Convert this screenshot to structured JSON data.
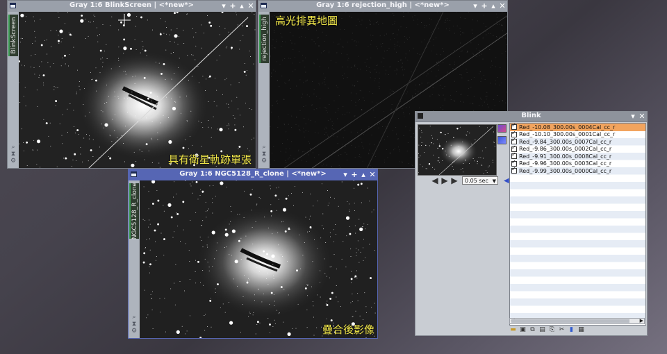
{
  "windows": {
    "blinkscreen": {
      "title": "Gray 1:6 BlinkScreen | <*new*>",
      "tab_label": "BlinkScreen",
      "caption": "具有衛星軌跡單張",
      "controls": [
        "▾",
        "✕"
      ]
    },
    "rejection": {
      "title": "Gray 1:6 rejection_high | <*new*>",
      "tab_label": "rejection_high",
      "caption": "高光排異地圖",
      "controls": [
        "▾",
        "✕"
      ]
    },
    "ngc": {
      "title": "Gray 1:6 NGC5128_R_clone | <*new*>",
      "tab_label": "NGC5128_R_clone",
      "caption": "疊合後影像",
      "controls": [
        "▾",
        "✕"
      ]
    }
  },
  "blink": {
    "title": "Blink",
    "interval": "0.05 sec",
    "files": [
      {
        "name": "Red_-10.08_300.00s_0004Cal_cc_r",
        "checked": true,
        "selected": true
      },
      {
        "name": "Red_-10.10_300.00s_0001Cal_cc_r",
        "checked": true,
        "selected": false
      },
      {
        "name": "Red_-9.84_300.00s_0007Cal_cc_r",
        "checked": true,
        "selected": false
      },
      {
        "name": "Red_-9.86_300.00s_0002Cal_cc_r",
        "checked": true,
        "selected": false
      },
      {
        "name": "Red_-9.91_300.00s_0008Cal_cc_r",
        "checked": true,
        "selected": false
      },
      {
        "name": "Red_-9.96_300.00s_0003Cal_cc_r",
        "checked": true,
        "selected": false
      },
      {
        "name": "Red_-9.99_300.00s_0000Cal_cc_r",
        "checked": true,
        "selected": false
      }
    ]
  },
  "colors": {
    "active_title": "#5666b4",
    "inactive_title": "#9aa0aa",
    "caption": "#f0e64a",
    "selected_row": "#f2a45e"
  }
}
